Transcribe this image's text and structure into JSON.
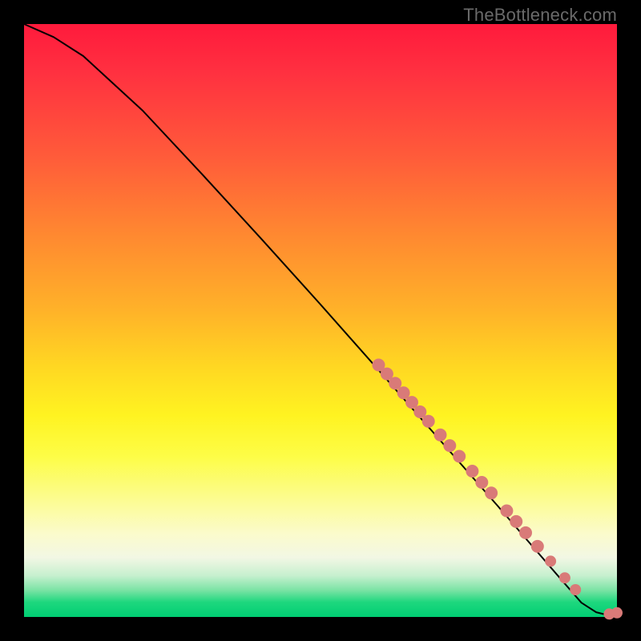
{
  "watermark": "TheBottleneck.com",
  "chart_data": {
    "type": "line",
    "title": "",
    "xlabel": "",
    "ylabel": "",
    "xlim": [
      0,
      100
    ],
    "ylim": [
      0,
      100
    ],
    "curve": {
      "name": "bottleneck-curve",
      "points": [
        {
          "x": 0.0,
          "y": 100.0
        },
        {
          "x": 5.0,
          "y": 97.8
        },
        {
          "x": 10.0,
          "y": 94.6
        },
        {
          "x": 20.0,
          "y": 85.4
        },
        {
          "x": 30.0,
          "y": 74.7
        },
        {
          "x": 40.0,
          "y": 63.8
        },
        {
          "x": 50.0,
          "y": 52.7
        },
        {
          "x": 60.0,
          "y": 41.4
        },
        {
          "x": 70.0,
          "y": 30.0
        },
        {
          "x": 80.0,
          "y": 18.6
        },
        {
          "x": 90.0,
          "y": 7.0
        },
        {
          "x": 94.0,
          "y": 2.4
        },
        {
          "x": 96.5,
          "y": 0.8
        },
        {
          "x": 98.5,
          "y": 0.3
        },
        {
          "x": 100.0,
          "y": 0.6
        }
      ]
    },
    "markers": {
      "name": "highlighted-points",
      "color": "#d97a78",
      "points": [
        {
          "x": 59.8,
          "y": 42.5,
          "r": 8
        },
        {
          "x": 61.2,
          "y": 41.0,
          "r": 8
        },
        {
          "x": 62.6,
          "y": 39.4,
          "r": 8
        },
        {
          "x": 64.0,
          "y": 37.8,
          "r": 8
        },
        {
          "x": 65.4,
          "y": 36.2,
          "r": 8
        },
        {
          "x": 66.8,
          "y": 34.6,
          "r": 8
        },
        {
          "x": 68.2,
          "y": 33.0,
          "r": 8
        },
        {
          "x": 70.2,
          "y": 30.7,
          "r": 8
        },
        {
          "x": 71.8,
          "y": 28.9,
          "r": 8
        },
        {
          "x": 73.4,
          "y": 27.1,
          "r": 8
        },
        {
          "x": 75.6,
          "y": 24.6,
          "r": 8
        },
        {
          "x": 77.2,
          "y": 22.7,
          "r": 8
        },
        {
          "x": 78.8,
          "y": 20.9,
          "r": 8
        },
        {
          "x": 81.4,
          "y": 17.9,
          "r": 8
        },
        {
          "x": 83.0,
          "y": 16.1,
          "r": 8
        },
        {
          "x": 84.6,
          "y": 14.2,
          "r": 8
        },
        {
          "x": 86.6,
          "y": 11.9,
          "r": 8
        },
        {
          "x": 88.8,
          "y": 9.4,
          "r": 7
        },
        {
          "x": 91.2,
          "y": 6.6,
          "r": 7
        },
        {
          "x": 93.0,
          "y": 4.6,
          "r": 7
        },
        {
          "x": 98.7,
          "y": 0.5,
          "r": 7
        },
        {
          "x": 100.0,
          "y": 0.7,
          "r": 7
        }
      ]
    }
  }
}
